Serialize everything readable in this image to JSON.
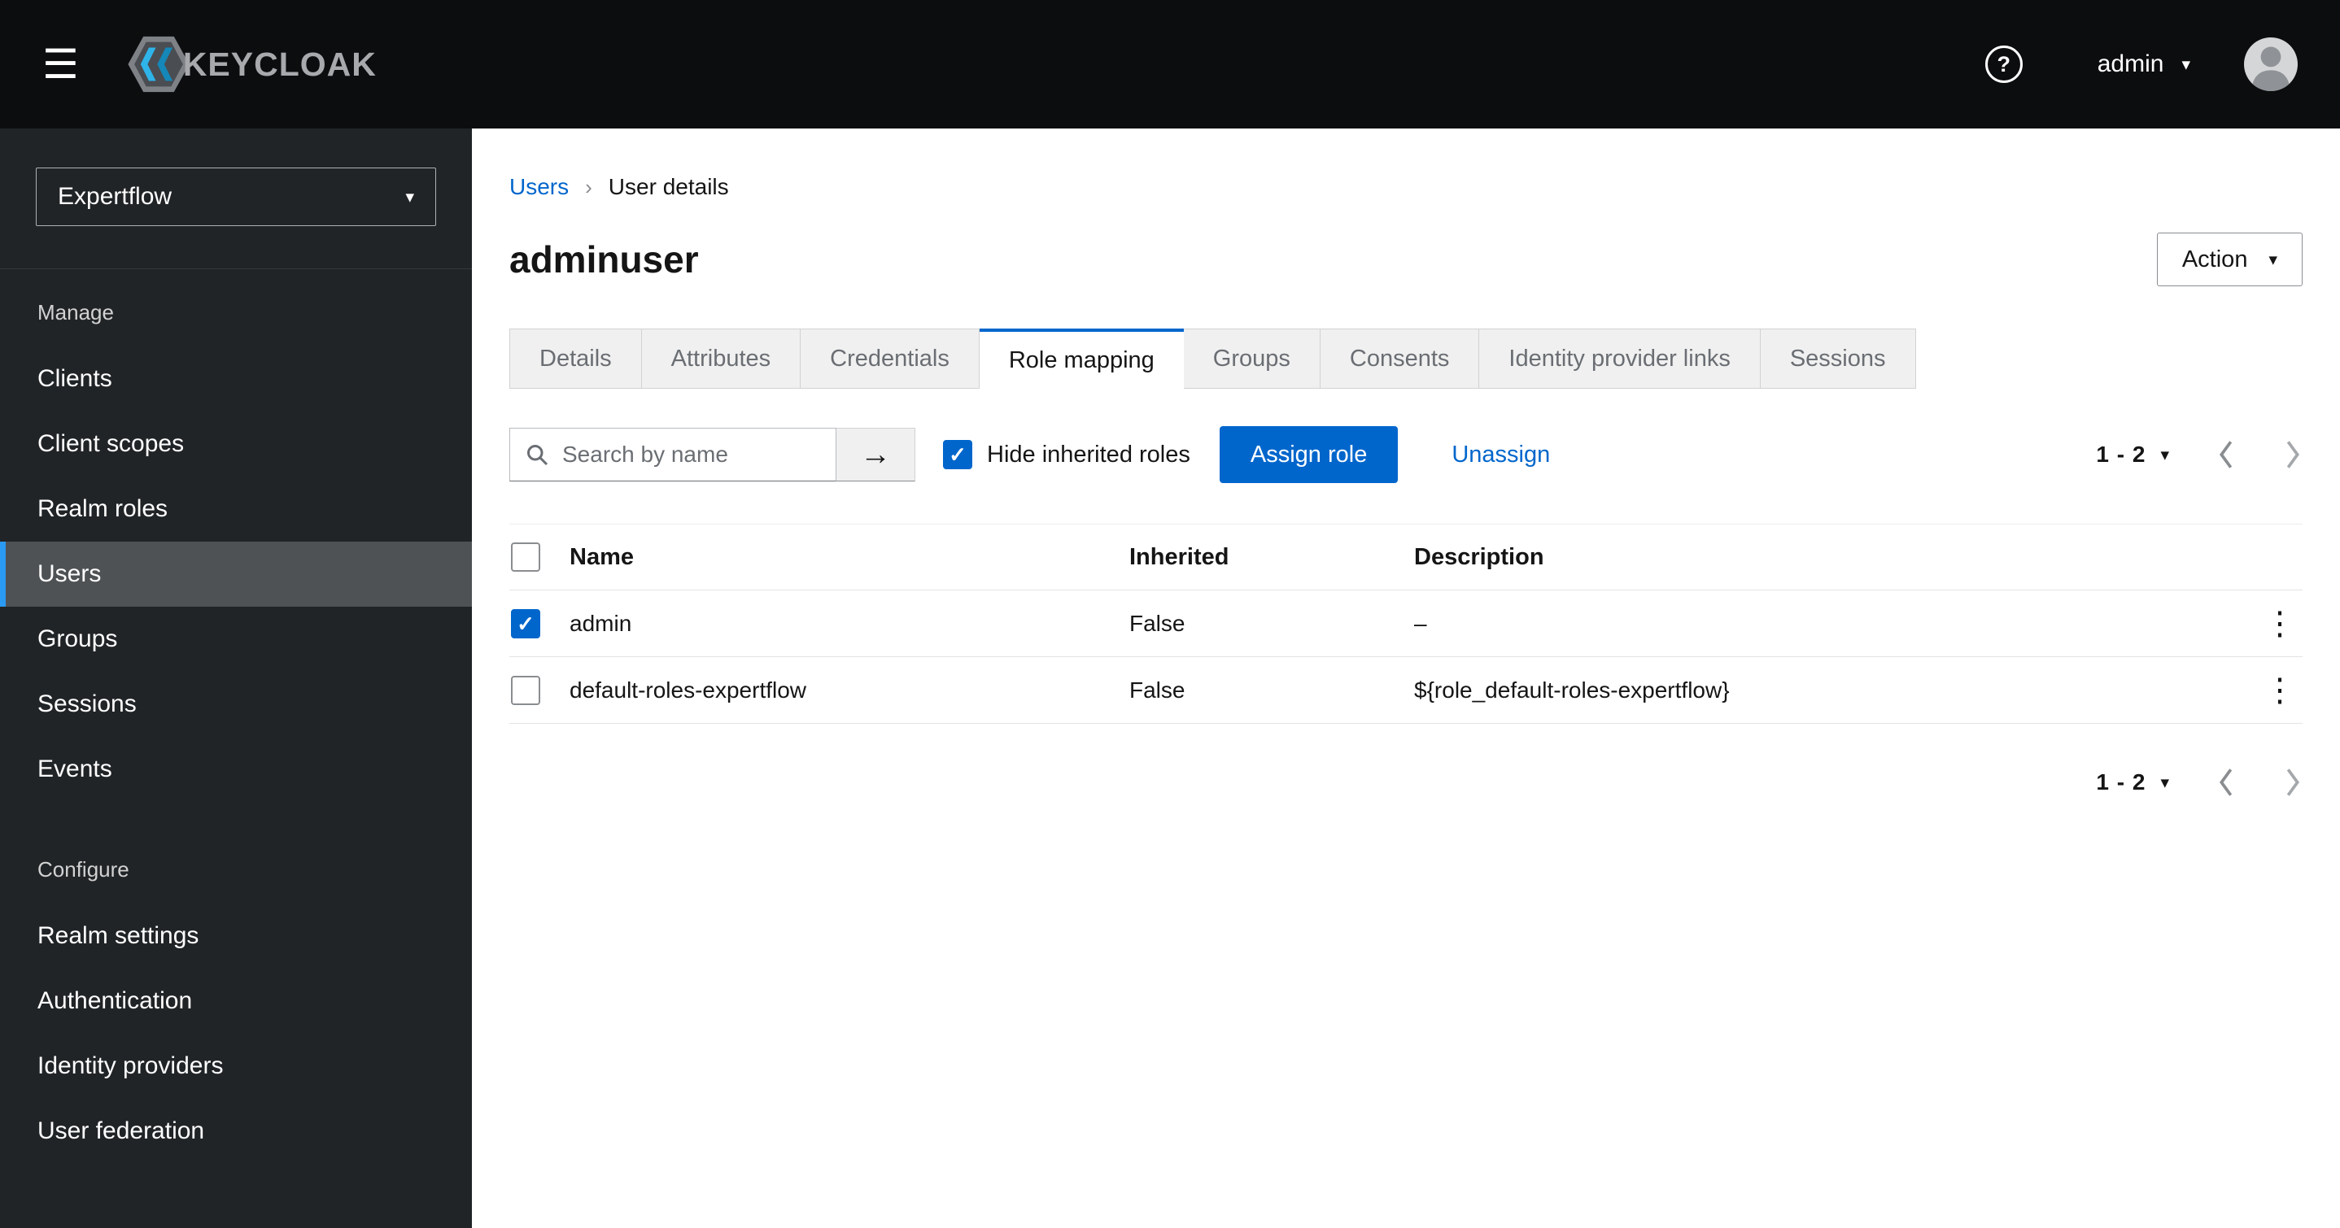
{
  "colors": {
    "primary": "#0066cc",
    "link": "#0066cc",
    "masthead_bg": "#0c0d0f",
    "sidebar_bg": "#212427",
    "sidebar_selected_bg": "#4f5255",
    "nav_accent": "#2b9af3",
    "tab_inactive_bg": "#f0f0f0",
    "border": "#d2d2d2"
  },
  "icons": {
    "hamburger": "☰",
    "help": "?",
    "caret_down": "▾",
    "check": "✓",
    "arrow_right": "→",
    "kebab": "⋮",
    "breadcrumb_sep": "›"
  },
  "header": {
    "brand": "KEYCLOAK",
    "username": "admin"
  },
  "sidebar": {
    "realm_selector": {
      "value": "Expertflow"
    },
    "sections": [
      {
        "label": "Manage",
        "items": [
          {
            "label": "Clients"
          },
          {
            "label": "Client scopes"
          },
          {
            "label": "Realm roles"
          },
          {
            "label": "Users",
            "selected": true
          },
          {
            "label": "Groups"
          },
          {
            "label": "Sessions"
          },
          {
            "label": "Events"
          }
        ]
      },
      {
        "label": "Configure",
        "items": [
          {
            "label": "Realm settings"
          },
          {
            "label": "Authentication"
          },
          {
            "label": "Identity providers"
          },
          {
            "label": "User federation"
          }
        ]
      }
    ]
  },
  "breadcrumb": {
    "items": [
      {
        "label": "Users"
      },
      {
        "label": "User details"
      }
    ]
  },
  "page": {
    "title": "adminuser",
    "action_button": "Action"
  },
  "tabs": [
    {
      "label": "Details"
    },
    {
      "label": "Attributes"
    },
    {
      "label": "Credentials"
    },
    {
      "label": "Role mapping",
      "active": true
    },
    {
      "label": "Groups"
    },
    {
      "label": "Consents"
    },
    {
      "label": "Identity provider links"
    },
    {
      "label": "Sessions"
    }
  ],
  "toolbar": {
    "search_placeholder": "Search by name",
    "search_value": "",
    "hide_inherited_label": "Hide inherited roles",
    "hide_inherited_checked": true,
    "assign_button": "Assign role",
    "unassign_link": "Unassign",
    "pagination_range": "1 - 2"
  },
  "table": {
    "columns": [
      {
        "label": "Name"
      },
      {
        "label": "Inherited"
      },
      {
        "label": "Description"
      }
    ],
    "rows": [
      {
        "checked": true,
        "name": "admin",
        "inherited": "False",
        "description": "–"
      },
      {
        "checked": false,
        "name": "default-roles-expertflow",
        "inherited": "False",
        "description": "${role_default-roles-expertflow}"
      }
    ]
  },
  "pagination_bottom": {
    "range": "1 - 2"
  }
}
